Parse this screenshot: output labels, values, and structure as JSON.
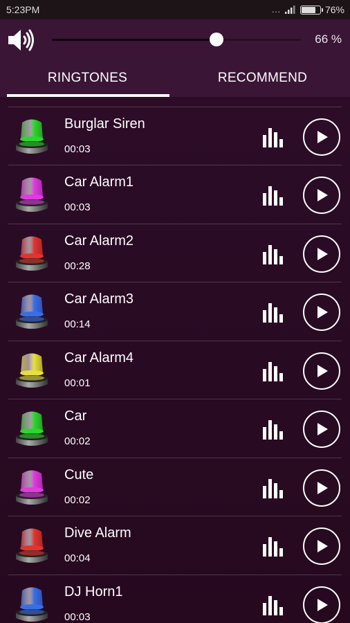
{
  "status": {
    "time": "5:23PM",
    "battery": "76%",
    "battery_level": 0.76
  },
  "volume": {
    "level_percent": 66,
    "label": "66 %"
  },
  "tabs": [
    {
      "label": "RINGTONES",
      "active": true
    },
    {
      "label": "RECOMMEND",
      "active": false
    }
  ],
  "ringtones": [
    {
      "name": "",
      "duration": "",
      "color": "#cfcfcf"
    },
    {
      "name": "Burglar Siren",
      "duration": "00:03",
      "color": "#2fd52f"
    },
    {
      "name": "Car Alarm1",
      "duration": "00:03",
      "color": "#e03ae0"
    },
    {
      "name": "Car Alarm2",
      "duration": "00:28",
      "color": "#e0352f"
    },
    {
      "name": "Car Alarm3",
      "duration": "00:14",
      "color": "#3a6ee6"
    },
    {
      "name": "Car Alarm4",
      "duration": "00:01",
      "color": "#e8e03a"
    },
    {
      "name": "Car",
      "duration": "00:02",
      "color": "#2fd52f"
    },
    {
      "name": "Cute",
      "duration": "00:02",
      "color": "#e03ae0"
    },
    {
      "name": "Dive Alarm",
      "duration": "00:04",
      "color": "#e0352f"
    },
    {
      "name": "DJ Horn1",
      "duration": "00:03",
      "color": "#3a6ee6"
    }
  ]
}
